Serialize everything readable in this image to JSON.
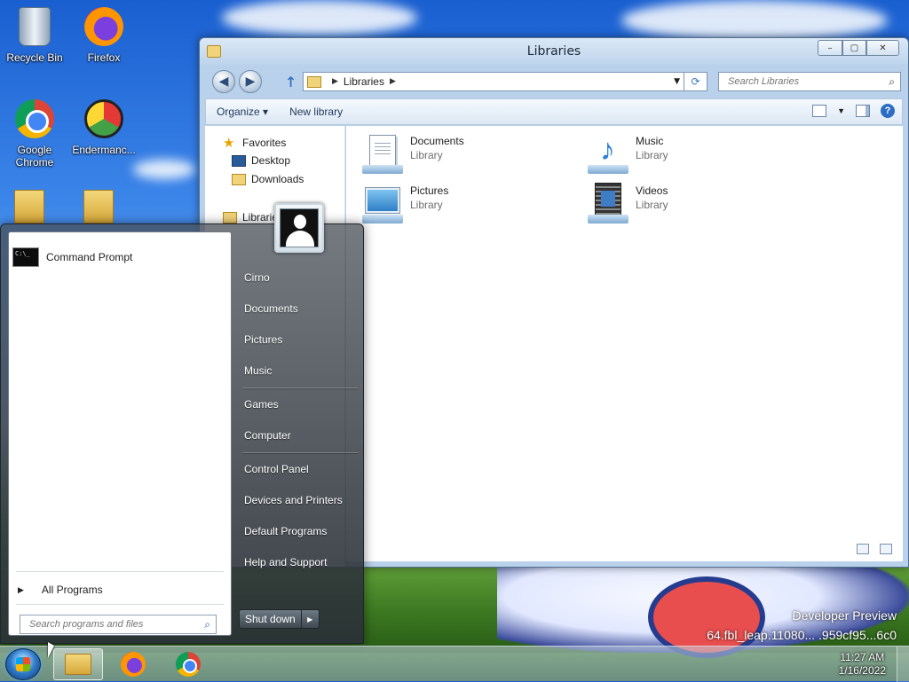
{
  "desktop": {
    "icons": [
      {
        "label": "Recycle Bin",
        "icon": "recycle-bin-icon"
      },
      {
        "label": "Firefox",
        "icon": "firefox-icon"
      },
      {
        "label": "Google Chrome",
        "icon": "chrome-icon"
      },
      {
        "label": "Endermanc...",
        "icon": "endermanch-icon"
      }
    ],
    "watermark": {
      "line1": "Developer Preview",
      "line2": "64.fbl_leap.11080... .959cf95...6c0"
    }
  },
  "explorer": {
    "title": "Libraries",
    "caption_buttons": {
      "minimize": "–",
      "maximize": "▢",
      "close": "✕"
    },
    "nav_back": "◀",
    "nav_forward": "▶",
    "nav_up": "↑",
    "address": {
      "crumb": "Libraries"
    },
    "search": {
      "placeholder": "Search Libraries"
    },
    "toolbar": {
      "organize": "Organize ▾",
      "new_library": "New library",
      "help": "?"
    },
    "nav_pane": {
      "favorites": "Favorites",
      "desktop": "Desktop",
      "downloads": "Downloads",
      "libraries": "Libraries"
    },
    "libraries": [
      {
        "name": "Documents",
        "sub": "Library"
      },
      {
        "name": "Music",
        "sub": "Library"
      },
      {
        "name": "Pictures",
        "sub": "Library"
      },
      {
        "name": "Videos",
        "sub": "Library"
      }
    ]
  },
  "start_menu": {
    "programs": [
      {
        "label": "Command Prompt",
        "icon": "command-prompt-icon"
      }
    ],
    "all_programs": "All Programs",
    "search": {
      "placeholder": "Search programs and files"
    },
    "right": {
      "user": "Cirno",
      "documents": "Documents",
      "pictures": "Pictures",
      "music": "Music",
      "games": "Games",
      "computer": "Computer",
      "control_panel": "Control Panel",
      "devices_printers": "Devices and Printers",
      "default_programs": "Default Programs",
      "help_support": "Help and Support"
    },
    "shutdown": "Shut down"
  },
  "taskbar": {
    "apps": [
      {
        "name": "Windows Explorer",
        "icon": "explorer-icon",
        "active": true
      },
      {
        "name": "Firefox",
        "icon": "firefox-icon",
        "active": false
      },
      {
        "name": "Google Chrome",
        "icon": "chrome-icon",
        "active": false
      }
    ],
    "clock": {
      "time": "11:27 AM",
      "date": "1/16/2022"
    }
  }
}
